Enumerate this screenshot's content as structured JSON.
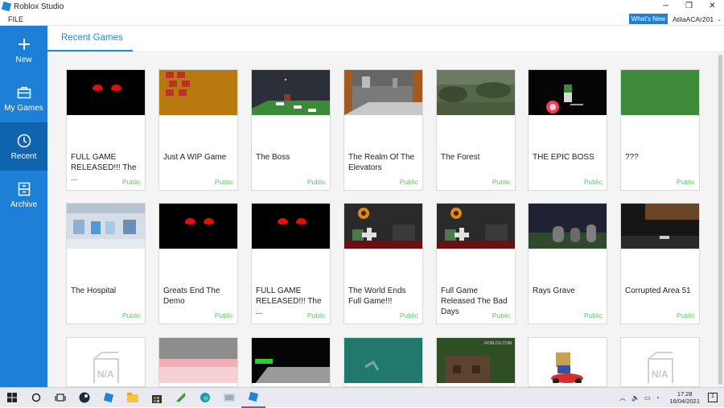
{
  "window": {
    "title": "Roblox Studio",
    "controls": [
      "─",
      "❐",
      "✕"
    ]
  },
  "menubar": {
    "file_label": "FILE",
    "whats_new_label": "What's New",
    "username": "AtilaACAr201"
  },
  "sidebar": {
    "items": [
      {
        "label": "New",
        "icon": "plus-icon"
      },
      {
        "label": "My Games",
        "icon": "briefcase-icon"
      },
      {
        "label": "Recent",
        "icon": "clock-icon",
        "active": true
      },
      {
        "label": "Archive",
        "icon": "archive-icon"
      }
    ]
  },
  "tabs": {
    "active_label": "Recent Games"
  },
  "games_row1": [
    {
      "title": "FULL GAME RELEASED!!! The ...",
      "status": "Public",
      "thumb": "red-eyes"
    },
    {
      "title": "Just A WIP Game",
      "status": "Public",
      "thumb": "orange-blocks"
    },
    {
      "title": "The Boss",
      "status": "Public",
      "thumb": "dark-room"
    },
    {
      "title": "The Realm Of The Elevators",
      "status": "Public",
      "thumb": "elevators"
    },
    {
      "title": "The Forest",
      "status": "Public",
      "thumb": "forest"
    },
    {
      "title": "THE EPIC BOSS",
      "status": "Public",
      "thumb": "epic-boss"
    },
    {
      "title": "???",
      "status": "Public",
      "thumb": "green-field"
    }
  ],
  "games_row2": [
    {
      "title": "The Hospital",
      "status": "Public",
      "thumb": "hospital"
    },
    {
      "title": "Greats End The Demo",
      "status": "Public",
      "thumb": "red-eyes"
    },
    {
      "title": "FULL GAME RELEASED!!! The ...",
      "status": "Public",
      "thumb": "red-eyes"
    },
    {
      "title": "The World Ends Full Game!!!",
      "status": "Public",
      "thumb": "world-ends"
    },
    {
      "title": "Full Game Released The Bad Days",
      "status": "Public",
      "thumb": "world-ends"
    },
    {
      "title": "Rays Grave",
      "status": "Public",
      "thumb": "grave"
    },
    {
      "title": "Corrupted Area 51",
      "status": "Public",
      "thumb": "area51"
    }
  ],
  "games_row3": [
    {
      "thumb": "na",
      "na_label": "N/A"
    },
    {
      "thumb": "pink-glow"
    },
    {
      "thumb": "green-bar"
    },
    {
      "thumb": "teal"
    },
    {
      "thumb": "house",
      "watermark": "ROBLOX.COM"
    },
    {
      "thumb": "cart"
    },
    {
      "thumb": "na",
      "na_label": "N/A"
    }
  ],
  "taskbar": {
    "time": "17:28",
    "date": "16/04/2021",
    "notification_count": "1"
  },
  "colors": {
    "accent": "#1e7fd6",
    "sidebar_active": "#0f65ad",
    "public_status": "#5cc46a",
    "tab_text": "#1e88e5"
  }
}
